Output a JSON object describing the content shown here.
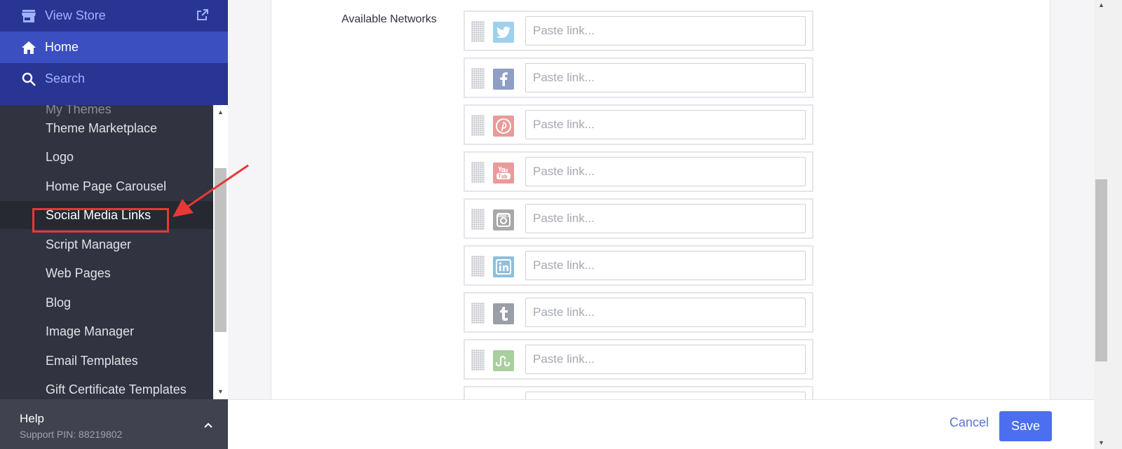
{
  "sidebar": {
    "top_nav": [
      {
        "label": "View Store",
        "icon": "store-icon"
      },
      {
        "label": "Home",
        "icon": "home-icon"
      },
      {
        "label": "Search",
        "icon": "search-icon"
      }
    ],
    "submenu": [
      {
        "label": "My Themes"
      },
      {
        "label": "Theme Marketplace"
      },
      {
        "label": "Logo"
      },
      {
        "label": "Home Page Carousel"
      },
      {
        "label": "Social Media Links",
        "active": true
      },
      {
        "label": "Script Manager"
      },
      {
        "label": "Web Pages"
      },
      {
        "label": "Blog"
      },
      {
        "label": "Image Manager"
      },
      {
        "label": "Email Templates"
      },
      {
        "label": "Gift Certificate Templates"
      }
    ],
    "help": {
      "title": "Help",
      "pin": "Support PIN: 88219802"
    }
  },
  "main": {
    "available_networks_label": "Available Networks",
    "networks": [
      {
        "name": "twitter",
        "icon": "twitter-icon",
        "color": "#9fd0ee",
        "placeholder": "Paste link..."
      },
      {
        "name": "facebook",
        "icon": "facebook-icon",
        "color": "#8e9ec4",
        "placeholder": "Paste link..."
      },
      {
        "name": "pinterest",
        "icon": "pinterest-icon",
        "color": "#e99a9a",
        "placeholder": "Paste link..."
      },
      {
        "name": "youtube",
        "icon": "youtube-icon",
        "color": "#e99a9a",
        "placeholder": "Paste link..."
      },
      {
        "name": "instagram",
        "icon": "instagram-icon",
        "color": "#a8a8a8",
        "placeholder": "Paste link..."
      },
      {
        "name": "linkedin",
        "icon": "linkedin-icon",
        "color": "#8fbfdc",
        "placeholder": "Paste link..."
      },
      {
        "name": "tumblr",
        "icon": "tumblr-icon",
        "color": "#9a9ea6",
        "placeholder": "Paste link..."
      },
      {
        "name": "stumbleupon",
        "icon": "stumbleupon-icon",
        "color": "#a8cf9d",
        "placeholder": "Paste link..."
      },
      {
        "name": "partial",
        "icon": "",
        "color": "#ffffff",
        "placeholder": ""
      }
    ],
    "footer": {
      "cancel_label": "Cancel",
      "save_label": "Save"
    }
  },
  "colors": {
    "sidebar_top": "#283593",
    "sidebar_active_top": "#3c4fc0",
    "sidebar_bg": "#313440",
    "primary_button": "#4b6ff0",
    "annotation": "#e53935"
  }
}
